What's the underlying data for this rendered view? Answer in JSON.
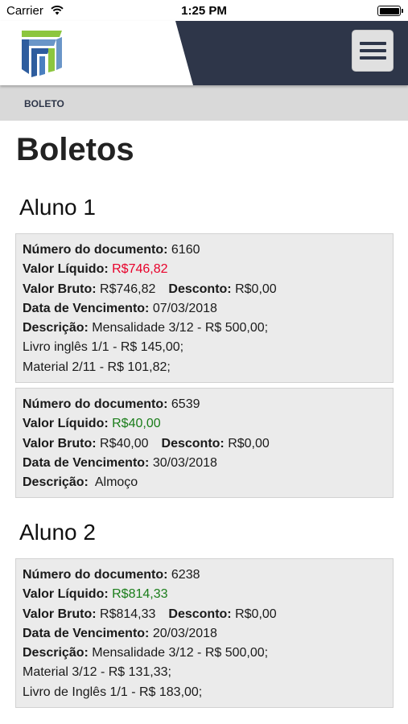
{
  "status_bar": {
    "carrier": "Carrier",
    "time": "1:25 PM"
  },
  "header": {
    "logo_icon": "school-logo-icon",
    "menu_icon": "hamburger-menu-icon",
    "navy_color": "#2e3649"
  },
  "breadcrumb": {
    "label": "BOLETO"
  },
  "page_title": "Boletos",
  "labels": {
    "numero": "Número do documento:",
    "liquido": "Valor Líquido:",
    "bruto": "Valor Bruto:",
    "desconto": "Desconto:",
    "vencimento": "Data de Vencimento:",
    "descricao": "Descrição:"
  },
  "colors": {
    "overdue": "#e8002a",
    "ok": "#1a7d1a"
  },
  "students": [
    {
      "name": "Aluno 1",
      "boletos": [
        {
          "numero": "6160",
          "liquido": "R$746,82",
          "bruto": "R$746,82",
          "desconto": "R$0,00",
          "vencimento": "07/03/2018",
          "descricao": [
            "Mensalidade 3/12 - R$ 500,00;",
            "Livro inglês 1/1 - R$ 145,00;",
            "Material 2/11 - R$ 101,82;"
          ]
        },
        {
          "numero": "6539",
          "liquido": "R$40,00",
          "bruto": "R$40,00",
          "desconto": "R$0,00",
          "vencimento": "30/03/2018",
          "descricao": [
            "Almoço"
          ]
        }
      ]
    },
    {
      "name": "Aluno 2",
      "boletos": [
        {
          "numero": "6238",
          "liquido": "R$814,33",
          "bruto": "R$814,33",
          "desconto": "R$0,00",
          "vencimento": "20/03/2018",
          "descricao": [
            "Mensalidade 3/12 - R$ 500,00;",
            "Material 3/12 - R$ 131,33;",
            "Livro de Inglês 1/1 - R$ 183,00;"
          ]
        }
      ]
    }
  ]
}
